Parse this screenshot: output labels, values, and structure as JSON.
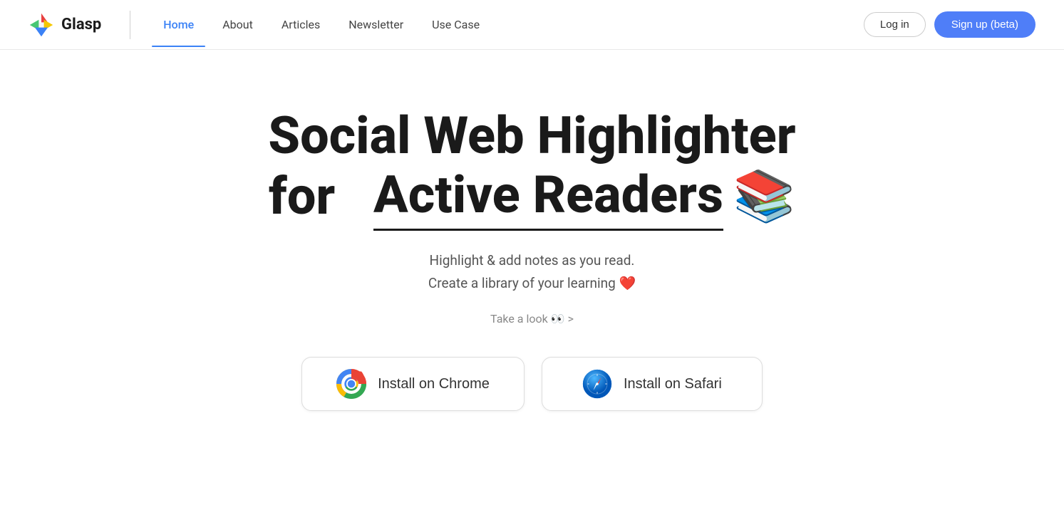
{
  "brand": {
    "name": "Glasp",
    "logo_alt": "Glasp logo"
  },
  "nav": {
    "links": [
      {
        "label": "Home",
        "active": true,
        "id": "home"
      },
      {
        "label": "About",
        "active": false,
        "id": "about"
      },
      {
        "label": "Articles",
        "active": false,
        "id": "articles"
      },
      {
        "label": "Newsletter",
        "active": false,
        "id": "newsletter"
      },
      {
        "label": "Use Case",
        "active": false,
        "id": "use-case"
      }
    ],
    "login_label": "Log in",
    "signup_label": "Sign up (beta)"
  },
  "hero": {
    "title_line1": "Social Web Highlighter",
    "title_line2_prefix": "for",
    "title_line2_underlined": "Active Readers",
    "title_emoji": "📚",
    "subtitle_line1": "Highlight & add notes as you read.",
    "subtitle_line2": "Create a library of your learning ❤️",
    "take_a_look": "Take a look 👀 >",
    "buttons": [
      {
        "id": "chrome",
        "label": "Install on Chrome",
        "icon_type": "chrome"
      },
      {
        "id": "safari",
        "label": "Install on Safari",
        "icon_type": "safari"
      }
    ]
  },
  "colors": {
    "accent_blue": "#4f7ef8",
    "nav_active": "#3b82f6",
    "text_dark": "#1a1a1a",
    "text_muted": "#888888"
  }
}
